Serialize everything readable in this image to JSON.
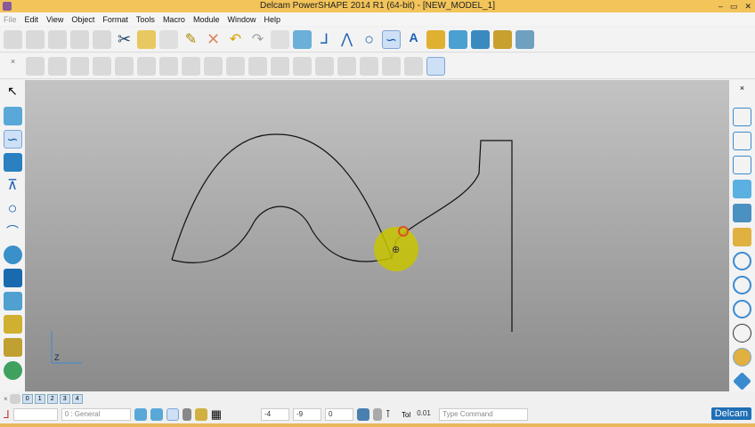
{
  "title": "Delcam PowerSHAPE 2014 R1 (64-bit) - [NEW_MODEL_1]",
  "window_buttons": [
    "–",
    "▭",
    "✕"
  ],
  "menu": [
    "File",
    "Edit",
    "View",
    "Object",
    "Format",
    "Tools",
    "Macro",
    "Module",
    "Window",
    "Help"
  ],
  "layers": [
    "0",
    "1",
    "2",
    "3",
    "4"
  ],
  "status": {
    "level": "0 : General",
    "x": "-4",
    "y": "-9",
    "z": "0",
    "tol_label": "Tol",
    "tol": "0.01",
    "command_placeholder": "Type Command",
    "brand": "Delcam"
  },
  "axis": {
    "z": "Z"
  },
  "colors": {
    "title": "#f2c45a",
    "accent": "#1f6fb5",
    "cursor": "#d4d400"
  }
}
